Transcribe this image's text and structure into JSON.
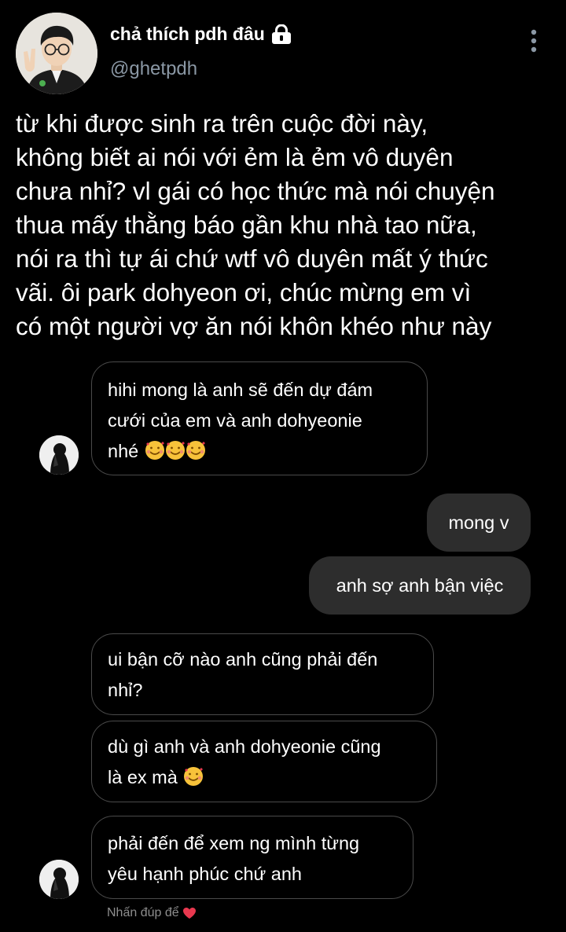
{
  "profile": {
    "display_name": "chả thích pdh đâu",
    "handle": "@ghetpdh",
    "lock_icon": "lock-icon",
    "more_icon": "more-vertical-icon"
  },
  "tweet": {
    "lines": [
      "từ khi được sinh ra trên cuộc đời này,",
      "không biết ai nói với ẻm là ẻm vô duyên",
      "chưa nhỉ? vl gái có học thức mà nói chuyện",
      "thua mấy thằng báo gần khu nhà tao nữa,",
      "nói ra thì tự ái chứ wtf vô duyên mất ý thức",
      "vãi. ôi park dohyeon ơi, chúc mừng em vì",
      "có một người vợ ăn nói khôn khéo như này"
    ]
  },
  "messages": [
    {
      "side": "in",
      "lines": [
        "hihi mong là anh sẽ đến dự đám",
        "cưới của em và anh dohyeonie",
        "nhé"
      ],
      "emoji": [
        "smiling-face-with-hearts",
        "smiling-face-with-hearts",
        "smiling-face-with-hearts"
      ]
    },
    {
      "side": "out",
      "lines": [
        "mong v"
      ]
    },
    {
      "side": "out",
      "lines": [
        "anh sợ anh bận việc"
      ]
    },
    {
      "side": "in",
      "lines": [
        "ui bận cỡ nào anh cũng phải đến",
        "nhỉ?"
      ]
    },
    {
      "side": "in",
      "lines": [
        "dù gì anh và anh dohyeonie cũng",
        "là ex mà"
      ],
      "emoji": [
        "smiling-face-with-hearts"
      ]
    },
    {
      "side": "in",
      "lines": [
        "phải đến để xem ng mình từng",
        "yêu hạnh phúc chứ anh"
      ]
    }
  ],
  "footer": {
    "hint": "Nhấn đúp để",
    "heart_icon": "heart-icon",
    "heart_color": "#e8384f"
  },
  "colors": {
    "background": "#000000",
    "handle_gray": "#8b98a5",
    "incoming_border": "#4a4a4a",
    "outgoing_fill": "#2d2d2d"
  }
}
